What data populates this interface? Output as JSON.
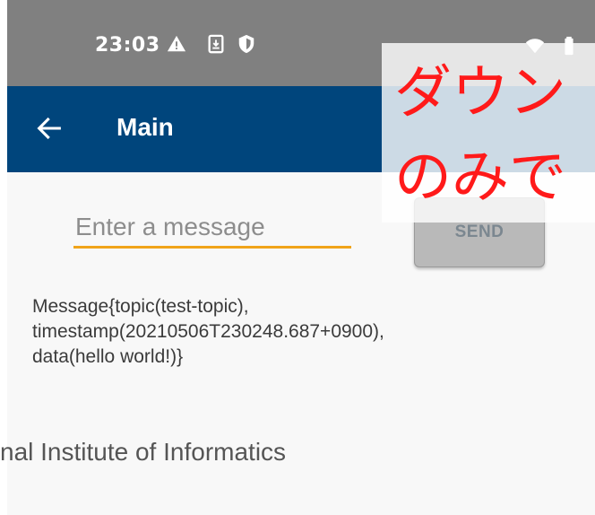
{
  "status_bar": {
    "time": "23:03",
    "icons": [
      "warning-icon",
      "download-icon",
      "shield-icon",
      "wifi-icon",
      "battery-icon"
    ]
  },
  "app_bar": {
    "title": "Main",
    "back_icon": "arrow-left-icon",
    "color": "#00457c"
  },
  "message_input": {
    "value": "",
    "placeholder": "Enter a message",
    "underline_color": "#f0a41a"
  },
  "send_button": {
    "label": "SEND"
  },
  "message_log": {
    "lines": [
      "Message{topic(test-topic),",
      "timestamp(20210506T230248.687+0900),",
      "data(hello world!)}"
    ]
  },
  "footer": {
    "text": "nal Institute of Informatics"
  },
  "overlay": {
    "line1": "ダウン",
    "line2": "のみで",
    "color": "#ff1a1a"
  }
}
